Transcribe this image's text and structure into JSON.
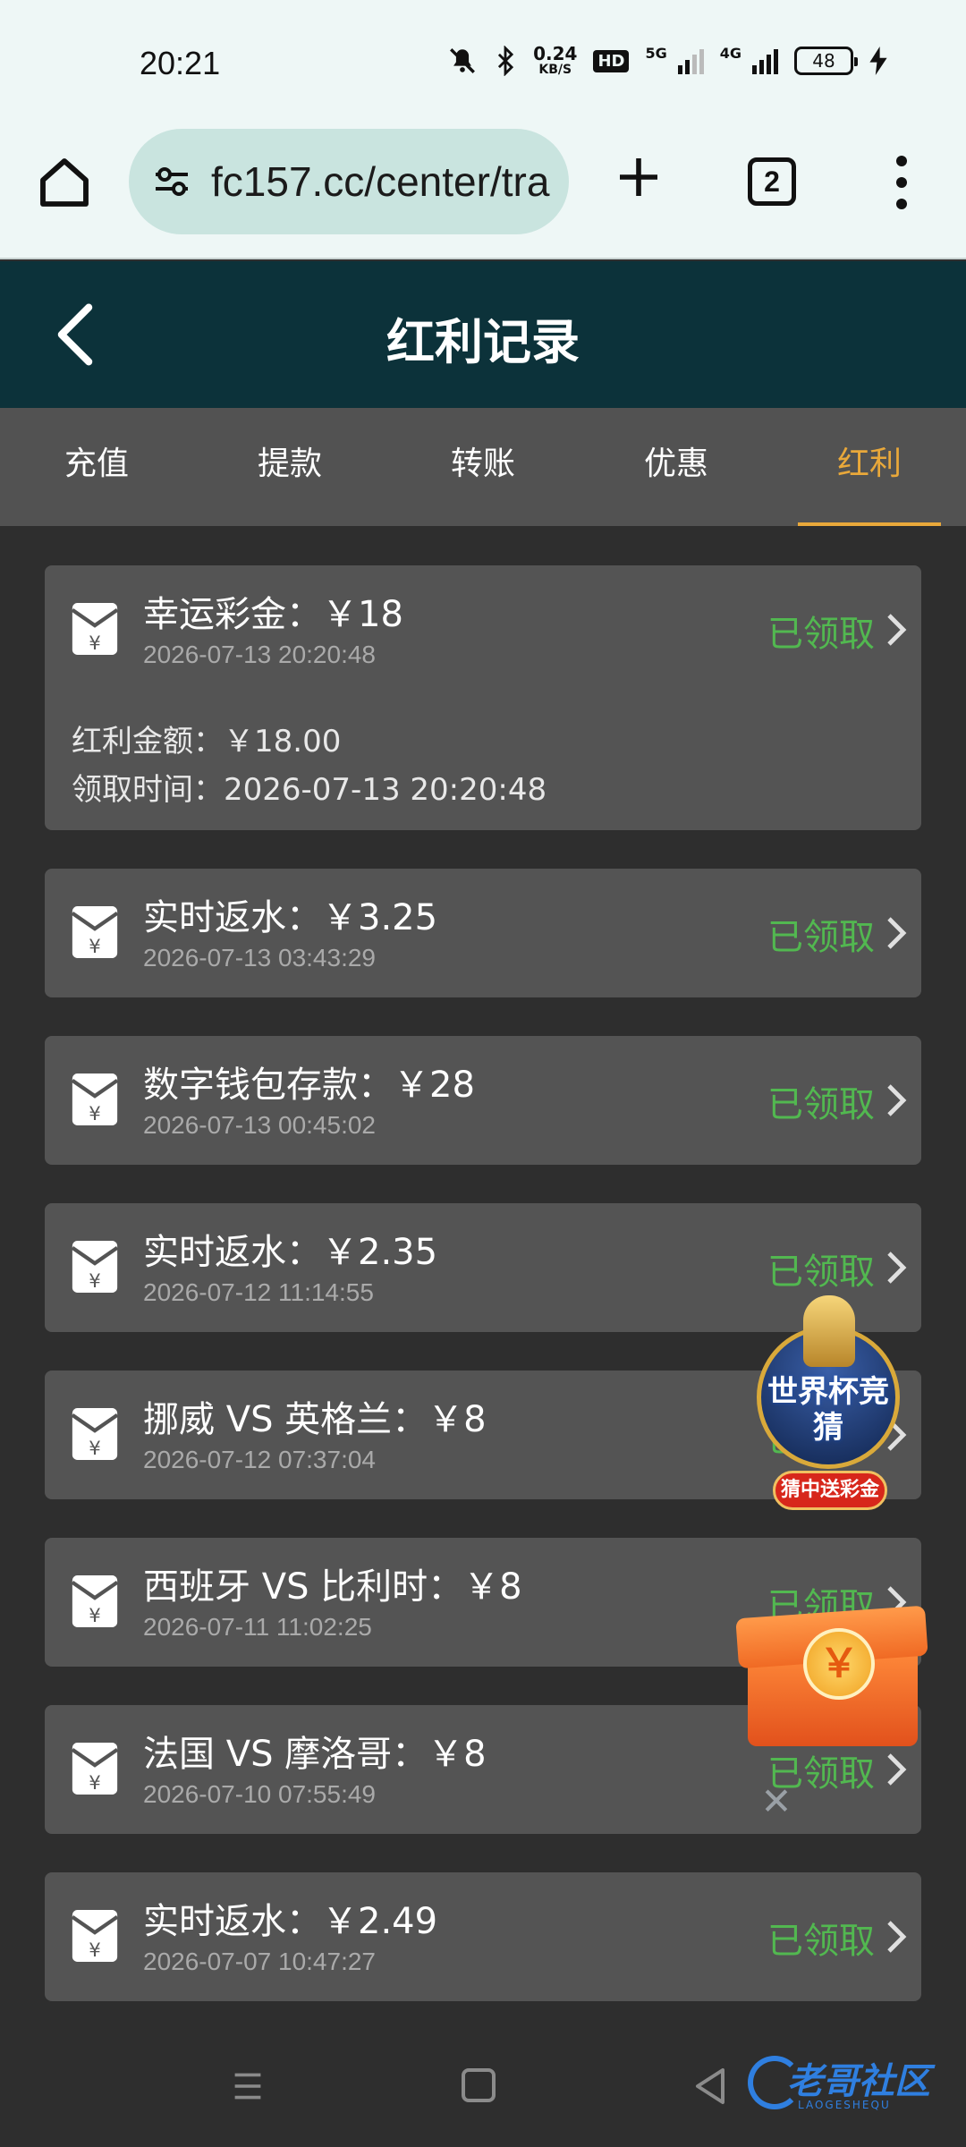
{
  "status_bar": {
    "time": "20:21",
    "net_speed_value": "0.24",
    "net_speed_unit": "KB/S",
    "hd_badge": "HD",
    "sig1_label": "5G",
    "sig2_label": "4G",
    "battery": "48"
  },
  "browser": {
    "url": "fc157.cc/center/tra",
    "tab_count": "2"
  },
  "header": {
    "title": "红利记录"
  },
  "tabs": [
    {
      "label": "充值",
      "active": false
    },
    {
      "label": "提款",
      "active": false
    },
    {
      "label": "转账",
      "active": false
    },
    {
      "label": "优惠",
      "active": false
    },
    {
      "label": "红利",
      "active": true
    }
  ],
  "records": [
    {
      "title": "幸运彩金：￥18",
      "date": "2026-07-13 20:20:48",
      "status": "已领取",
      "expanded": true,
      "detail_amount": "红利金额：￥18.00",
      "detail_time": "领取时间：2026-07-13 20:20:48"
    },
    {
      "title": "实时返水：￥3.25",
      "date": "2026-07-13 03:43:29",
      "status": "已领取"
    },
    {
      "title": "数字钱包存款：￥28",
      "date": "2026-07-13 00:45:02",
      "status": "已领取"
    },
    {
      "title": "实时返水：￥2.35",
      "date": "2026-07-12 11:14:55",
      "status": "已领取"
    },
    {
      "title": "挪威 VS 英格兰：￥8",
      "date": "2026-07-12 07:37:04",
      "status": "已领取"
    },
    {
      "title": "西班牙 VS 比利时：￥8",
      "date": "2026-07-11 11:02:25",
      "status": "已领取"
    },
    {
      "title": "法国 VS 摩洛哥：￥8",
      "date": "2026-07-10 07:55:49",
      "status": "已领取"
    },
    {
      "title": "实时返水：￥2.49",
      "date": "2026-07-07 10:47:27",
      "status": "已领取"
    }
  ],
  "promos": {
    "cup_title": "世界杯竞猜",
    "cup_ribbon": "猜中送彩金",
    "gift_coin": "￥",
    "close": "✕"
  },
  "watermark": {
    "text": "老哥社区",
    "sub": "LAOGESHEQU"
  },
  "colors": {
    "header_bg": "#0c323a",
    "tab_active": "#e9a83a",
    "status_received": "#52b850",
    "card_bg": "#545454",
    "page_bg": "#2e2e2e"
  }
}
